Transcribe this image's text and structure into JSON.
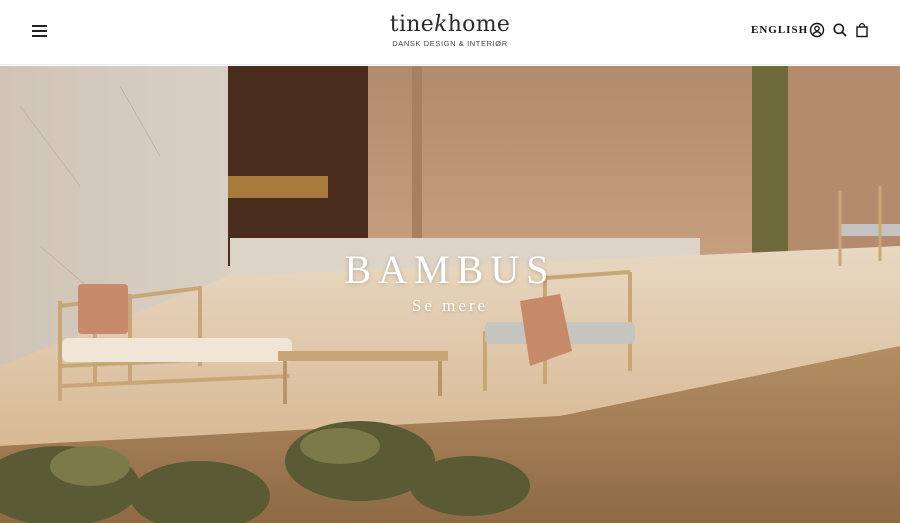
{
  "header": {
    "logo_text_a": "tine",
    "logo_text_k": "k",
    "logo_text_b": "home",
    "logo_tagline": "DANSK DESIGN & INTERIØR",
    "language_link": "ENGLISH",
    "icons": [
      "menu-icon",
      "account-icon",
      "search-icon",
      "bag-icon"
    ]
  },
  "hero": {
    "title": "BAMBUS",
    "cta": "Se mere"
  },
  "colors": {
    "header_bg": "#ffffff",
    "text_dark": "#111111",
    "hero_text": "#ffffff"
  }
}
